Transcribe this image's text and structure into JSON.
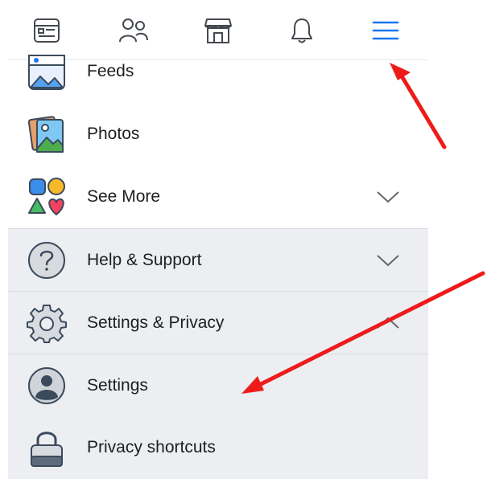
{
  "topbar": {
    "tabs": [
      {
        "icon": "news-feed-icon"
      },
      {
        "icon": "friends-icon"
      },
      {
        "icon": "marketplace-icon"
      },
      {
        "icon": "notifications-bell-icon"
      },
      {
        "icon": "menu-icon",
        "active": true
      }
    ]
  },
  "menu": {
    "feeds_label": "Feeds",
    "photos_label": "Photos",
    "see_more_label": "See More",
    "help_label": "Help & Support",
    "settings_privacy_label": "Settings & Privacy",
    "settings_label": "Settings",
    "privacy_shortcuts_label": "Privacy shortcuts"
  },
  "colors": {
    "accent": "#1877f2",
    "annotation_arrow": "#ee1b1b",
    "section_shade": "#eceef2"
  }
}
